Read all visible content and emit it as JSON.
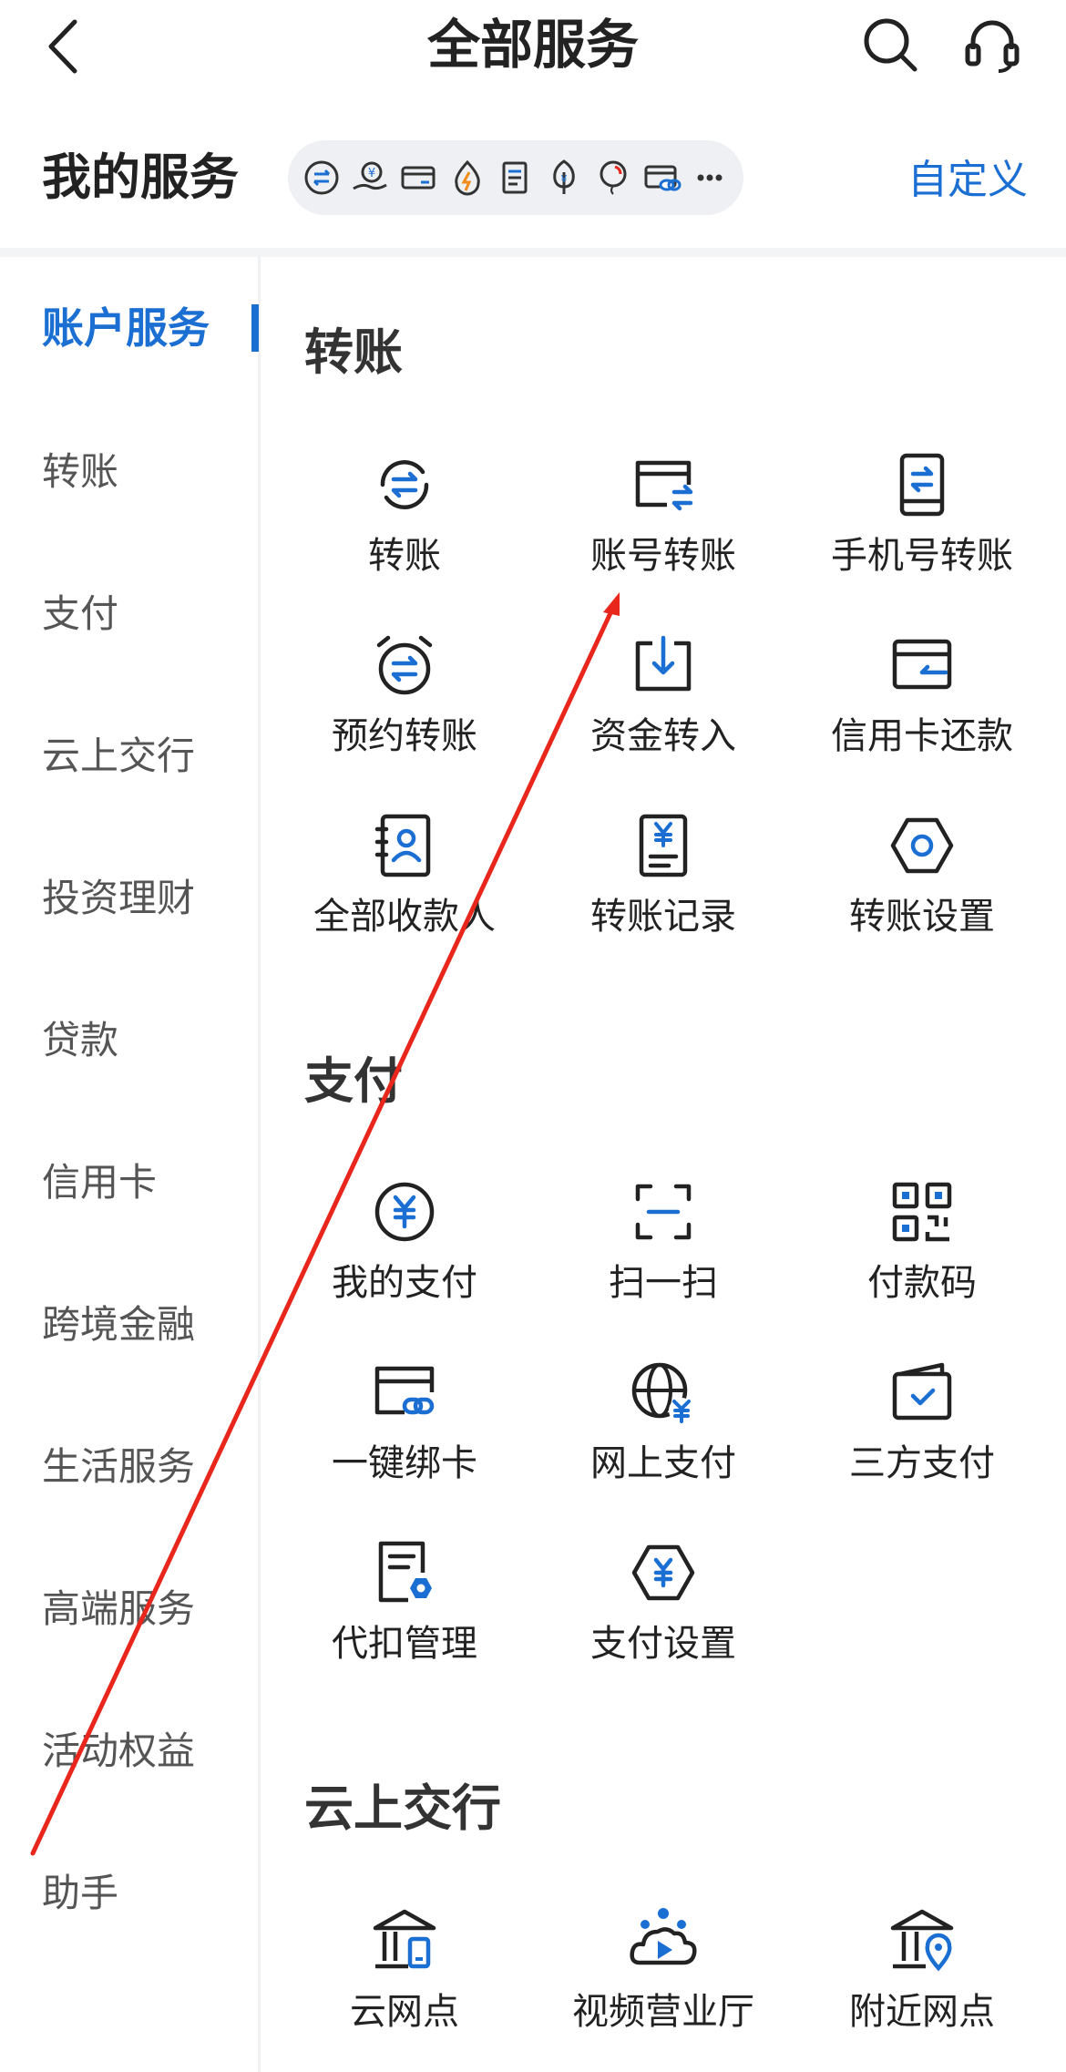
{
  "header": {
    "title": "全部服务",
    "back_icon": "chevron-left-icon",
    "search_icon": "search-icon",
    "service_icon": "headset-icon"
  },
  "my_services": {
    "title": "我的服务",
    "customize_label": "自定义",
    "icons": [
      "transfer-icon",
      "hand-coin-icon",
      "card-icon",
      "lightning-icon",
      "document-icon",
      "tree-icon",
      "balloon-icon",
      "card-link-icon",
      "more-icon"
    ]
  },
  "sidebar": {
    "items": [
      {
        "label": "账户服务",
        "active": true
      },
      {
        "label": "转账"
      },
      {
        "label": "支付"
      },
      {
        "label": "云上交行"
      },
      {
        "label": "投资理财"
      },
      {
        "label": "贷款"
      },
      {
        "label": "信用卡"
      },
      {
        "label": "跨境金融"
      },
      {
        "label": "生活服务"
      },
      {
        "label": "高端服务"
      },
      {
        "label": "活动权益"
      },
      {
        "label": "助手"
      }
    ]
  },
  "sections": [
    {
      "title": "转账",
      "items": [
        {
          "label": "转账",
          "icon": "transfer-circle-icon"
        },
        {
          "label": "账号转账",
          "icon": "account-transfer-icon"
        },
        {
          "label": "手机号转账",
          "icon": "phone-transfer-icon"
        },
        {
          "label": "预约转账",
          "icon": "alarm-transfer-icon"
        },
        {
          "label": "资金转入",
          "icon": "fund-in-icon"
        },
        {
          "label": "信用卡还款",
          "icon": "credit-card-repay-icon"
        },
        {
          "label": "全部收款人",
          "icon": "payee-list-icon"
        },
        {
          "label": "转账记录",
          "icon": "transfer-record-icon"
        },
        {
          "label": "转账设置",
          "icon": "hexagon-settings-icon"
        }
      ]
    },
    {
      "title": "支付",
      "items": [
        {
          "label": "我的支付",
          "icon": "yuan-circle-icon"
        },
        {
          "label": "扫一扫",
          "icon": "scan-icon"
        },
        {
          "label": "付款码",
          "icon": "qr-code-icon"
        },
        {
          "label": "一键绑卡",
          "icon": "card-bind-icon"
        },
        {
          "label": "网上支付",
          "icon": "globe-yuan-icon"
        },
        {
          "label": "三方支付",
          "icon": "wallet-check-icon"
        },
        {
          "label": "代扣管理",
          "icon": "document-gear-icon"
        },
        {
          "label": "支付设置",
          "icon": "hexagon-yuan-icon"
        }
      ]
    },
    {
      "title": "云上交行",
      "items": [
        {
          "label": "云网点",
          "icon": "cloud-branch-icon"
        },
        {
          "label": "视频营业厅",
          "icon": "video-hall-icon"
        },
        {
          "label": "附近网点",
          "icon": "nearby-branch-icon"
        }
      ]
    }
  ],
  "colors": {
    "accent": "#1b6fd3",
    "annotation_arrow": "#e8261c"
  }
}
